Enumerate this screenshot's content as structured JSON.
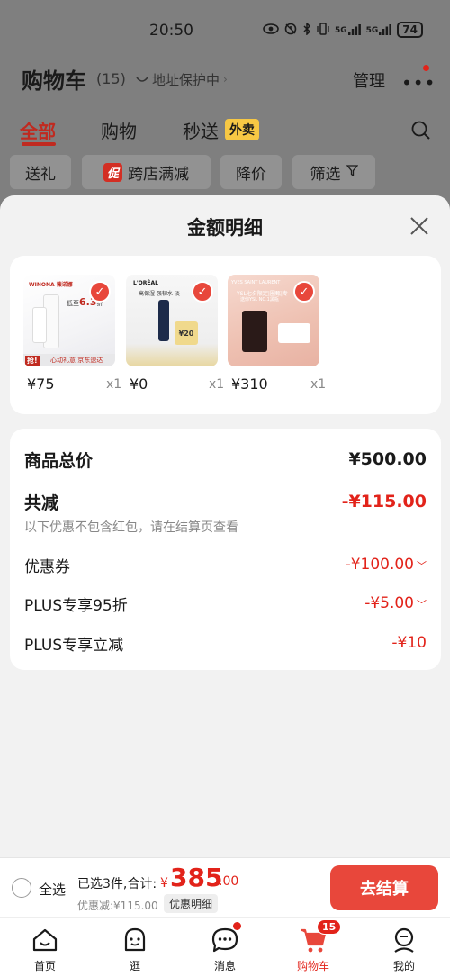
{
  "status_bar": {
    "time": "20:50",
    "battery": "74",
    "signal1": "5G",
    "signal2": "5G"
  },
  "header": {
    "title": "购物车",
    "count": "(15)",
    "address": "地址保护中",
    "manage": "管理"
  },
  "tabs": {
    "all": "全部",
    "shopping": "购物",
    "express": "秒送",
    "waimai": "外卖"
  },
  "filters": {
    "gift": "送礼",
    "promo_tag": "促",
    "cross_store": "跨店满减",
    "price_drop": "降价",
    "filter": "筛选"
  },
  "sheet": {
    "title": "金额明细",
    "products": [
      {
        "price": "¥75",
        "qty": "x1",
        "theme": "winona"
      },
      {
        "price": "¥0",
        "qty": "x1",
        "theme": "loreal"
      },
      {
        "price": "¥310",
        "qty": "x1",
        "theme": "ysl"
      }
    ],
    "product_texts": {
      "p1_brand": "WINONA 薇诺娜",
      "p1_disc_a": "低至",
      "p1_disc_b": "6.3",
      "p1_disc_c": "折",
      "p1_badge": "抢!",
      "p1_banner": "心动礼意 京东速达",
      "p2_brand": "L'ORÉAL",
      "p2_line": "高保湿 强韧水 淡",
      "p2_price": "¥20",
      "p3_brand": "YVES SAINT LAURENT",
      "p3_line": "YSL七夕限定|圈甄|专",
      "p3_sub": "送你YSL NO.1黑瓶"
    },
    "summary": {
      "subtotal_label": "商品总价",
      "subtotal_value": "¥500.00",
      "total_off_label": "共减",
      "total_off_value": "-¥115.00",
      "note": "以下优惠不包含红包，请在结算页查看",
      "coupon_label": "优惠券",
      "coupon_value": "-¥100.00",
      "plus95_label": "PLUS专享95折",
      "plus95_value": "-¥5.00",
      "plus_off_label": "PLUS专享立减",
      "plus_off_value": "-¥10"
    }
  },
  "checkout": {
    "select_all": "全选",
    "selected": "已选3件,合计:",
    "currency": "¥",
    "total_int": "385",
    "total_dec": ".00",
    "discount": "优惠减:¥115.00",
    "detail_btn": "优惠明细",
    "go_btn": "去结算"
  },
  "nav": {
    "home": "首页",
    "browse": "逛",
    "messages": "消息",
    "cart": "购物车",
    "cart_badge": "15",
    "mine": "我的"
  }
}
